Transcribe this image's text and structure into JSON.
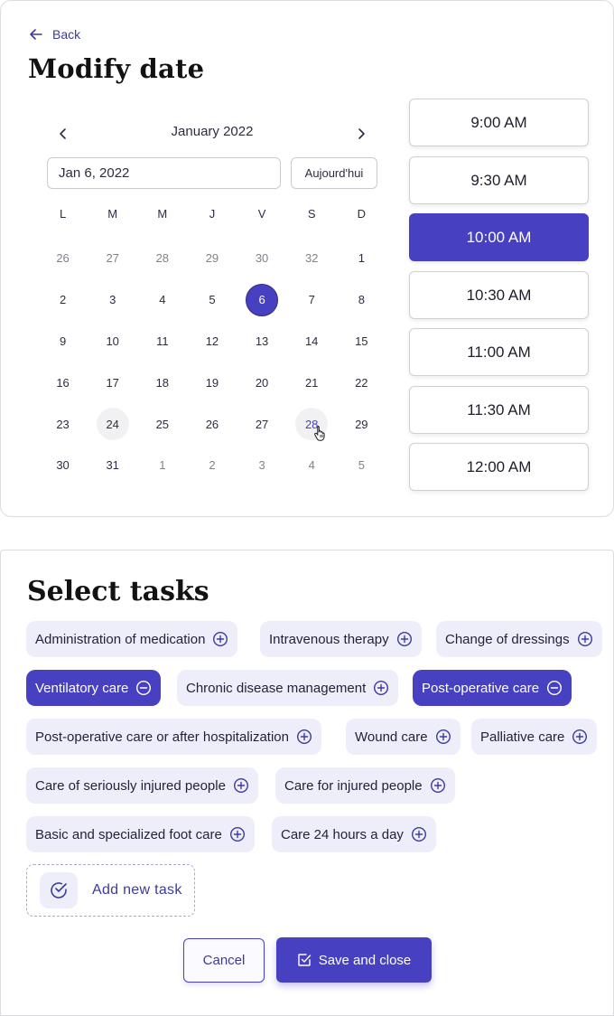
{
  "modify_date": {
    "back_label": "Back",
    "title": "Modify date",
    "calendar": {
      "month_label": "January 2022",
      "date_value": "Jan 6, 2022",
      "today_label": "Aujourd'hui",
      "weekdays": [
        "L",
        "M",
        "M",
        "J",
        "V",
        "S",
        "D"
      ],
      "days": [
        {
          "label": "26",
          "state": "other"
        },
        {
          "label": "27",
          "state": "other"
        },
        {
          "label": "28",
          "state": "other"
        },
        {
          "label": "29",
          "state": "other"
        },
        {
          "label": "30",
          "state": "other"
        },
        {
          "label": "32",
          "state": "other"
        },
        {
          "label": "1",
          "state": "cur"
        },
        {
          "label": "2",
          "state": "cur"
        },
        {
          "label": "3",
          "state": "cur"
        },
        {
          "label": "4",
          "state": "cur"
        },
        {
          "label": "5",
          "state": "cur"
        },
        {
          "label": "6",
          "state": "sel"
        },
        {
          "label": "7",
          "state": "cur"
        },
        {
          "label": "8",
          "state": "cur"
        },
        {
          "label": "9",
          "state": "cur"
        },
        {
          "label": "10",
          "state": "cur"
        },
        {
          "label": "11",
          "state": "cur"
        },
        {
          "label": "12",
          "state": "cur"
        },
        {
          "label": "13",
          "state": "cur"
        },
        {
          "label": "14",
          "state": "cur"
        },
        {
          "label": "15",
          "state": "cur"
        },
        {
          "label": "16",
          "state": "cur"
        },
        {
          "label": "17",
          "state": "cur"
        },
        {
          "label": "18",
          "state": "cur"
        },
        {
          "label": "19",
          "state": "cur"
        },
        {
          "label": "20",
          "state": "cur"
        },
        {
          "label": "21",
          "state": "cur"
        },
        {
          "label": "22",
          "state": "cur"
        },
        {
          "label": "23",
          "state": "cur"
        },
        {
          "label": "24",
          "state": "hl"
        },
        {
          "label": "25",
          "state": "cur"
        },
        {
          "label": "26",
          "state": "cur"
        },
        {
          "label": "27",
          "state": "cur"
        },
        {
          "label": "28",
          "state": "hover"
        },
        {
          "label": "29",
          "state": "cur"
        },
        {
          "label": "30",
          "state": "cur"
        },
        {
          "label": "31",
          "state": "cur"
        },
        {
          "label": "1",
          "state": "other"
        },
        {
          "label": "2",
          "state": "other"
        },
        {
          "label": "3",
          "state": "other"
        },
        {
          "label": "4",
          "state": "other"
        },
        {
          "label": "5",
          "state": "other"
        }
      ]
    },
    "time_slots": [
      {
        "label": "9:00 AM",
        "selected": false
      },
      {
        "label": "9:30 AM",
        "selected": false
      },
      {
        "label": "10:00 AM",
        "selected": true
      },
      {
        "label": "10:30 AM",
        "selected": false
      },
      {
        "label": "11:00 AM",
        "selected": false
      },
      {
        "label": "11:30 AM",
        "selected": false
      },
      {
        "label": "12:00 AM",
        "selected": false
      }
    ]
  },
  "select_tasks": {
    "title": "Select tasks",
    "tasks": [
      {
        "label": "Administration of medication",
        "selected": false
      },
      {
        "label": "Intravenous therapy",
        "selected": false
      },
      {
        "label": "Change of dressings",
        "selected": false
      },
      {
        "label": "Ventilatory care",
        "selected": true
      },
      {
        "label": "Chronic disease management",
        "selected": false
      },
      {
        "label": "Post-operative care",
        "selected": true
      },
      {
        "label": "Post-operative care or after hospitalization",
        "selected": false
      },
      {
        "label": "Wound care",
        "selected": false
      },
      {
        "label": "Palliative care",
        "selected": false
      },
      {
        "label": "Care of seriously injured people",
        "selected": false
      },
      {
        "label": "Care for injured people",
        "selected": false
      },
      {
        "label": "Basic and specialized foot care",
        "selected": false
      },
      {
        "label": "Care 24 hours a day",
        "selected": false
      }
    ],
    "add_task_label": "Add new task",
    "cancel_label": "Cancel",
    "save_label": "Save and close"
  },
  "colors": {
    "accent": "#4740c1",
    "chip_bg": "#eeeefb",
    "text": "#2b2d42",
    "muted": "#80828d"
  },
  "icons": {
    "back": "arrow-left-icon",
    "prev": "chevron-left-icon",
    "next": "chevron-right-icon",
    "add": "plus-circle-icon",
    "remove": "minus-circle-icon",
    "add_task": "check-circle-icon",
    "save": "checkbox-icon"
  }
}
